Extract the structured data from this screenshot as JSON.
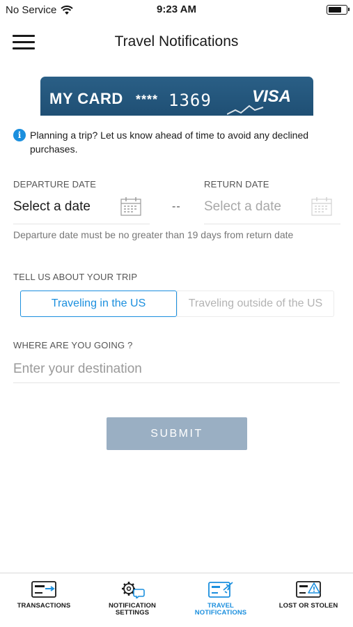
{
  "status": {
    "carrier": "No Service",
    "time": "9:23 AM",
    "battery_level": 0.8
  },
  "header": {
    "title": "Travel Notifications",
    "menu_icon": "hamburger-menu-icon"
  },
  "card": {
    "name": "MY CARD",
    "mask": "****",
    "last4": "1369",
    "brand": "VISA"
  },
  "info": {
    "icon": "info-icon",
    "text": "Planning a trip? Let us know ahead of time to avoid any declined purchases."
  },
  "dates": {
    "departure_label": "DEPARTURE DATE",
    "departure_value": "Select a date",
    "separator": "--",
    "return_label": "RETURN DATE",
    "return_value": "Select a date",
    "hint": "Departure date must be no greater than 19 days from return date"
  },
  "trip": {
    "label": "TELL US ABOUT YOUR TRIP",
    "options": [
      "Traveling in the US",
      "Traveling outside of the US"
    ],
    "selected": "Traveling in the US"
  },
  "destination": {
    "label": "WHERE ARE YOU GOING ?",
    "placeholder": "Enter your destination",
    "value": ""
  },
  "submit_label": "SUBMIT",
  "tabs": [
    {
      "label_line1": "TRANSACTIONS",
      "label_line2": "",
      "icon": "card-transfer-icon",
      "active": false
    },
    {
      "label_line1": "NOTIFICATION",
      "label_line2": "SETTINGS",
      "icon": "gear-chat-icon",
      "active": false
    },
    {
      "label_line1": "TRAVEL",
      "label_line2": "NOTIFICATIONS",
      "icon": "card-airplane-icon",
      "active": true
    },
    {
      "label_line1": "LOST OR STOLEN",
      "label_line2": "",
      "icon": "card-warning-icon",
      "active": false
    }
  ],
  "colors": {
    "accent": "#1b8fde",
    "card": "#245a80",
    "submit_disabled": "#9aafc3"
  }
}
